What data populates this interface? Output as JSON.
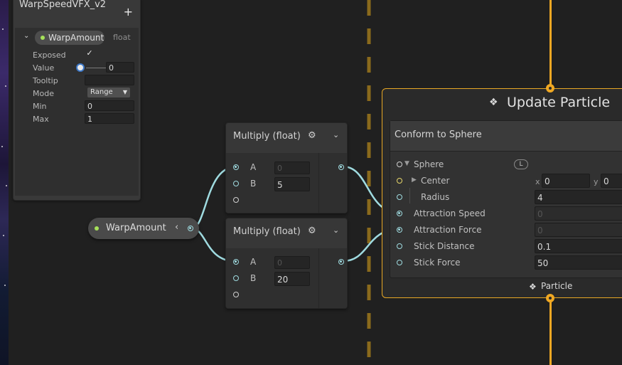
{
  "blackboard": {
    "title": "WarpSpeedVFX_v2",
    "add_icon": "plus-icon",
    "property": {
      "name": "WarpAmount",
      "type": "float",
      "exposed_label": "Exposed",
      "exposed_checked": true,
      "value_label": "Value",
      "value": "0",
      "tooltip_label": "Tooltip",
      "tooltip": "",
      "mode_label": "Mode",
      "mode": "Range",
      "min_label": "Min",
      "min": "0",
      "max_label": "Max",
      "max": "1"
    }
  },
  "warp_node": {
    "label": "WarpAmount"
  },
  "multiply_nodes": [
    {
      "title": "Multiply (float)",
      "a_label": "A",
      "a_value": "0",
      "b_label": "B",
      "b_value": "5"
    },
    {
      "title": "Multiply (float)",
      "a_label": "A",
      "a_value": "0",
      "b_label": "B",
      "b_value": "20"
    }
  ],
  "update_context": {
    "title": "Update Particle",
    "footer": "Particle",
    "block": {
      "title": "Conform to Sphere",
      "space_badge": "L",
      "rows": [
        {
          "label": "Sphere",
          "value": ""
        },
        {
          "label": "Center",
          "x_label": "x",
          "x": "0",
          "y_label": "y",
          "y": "0"
        },
        {
          "label": "Radius",
          "value": "4"
        },
        {
          "label": "Attraction Speed",
          "value": "0"
        },
        {
          "label": "Attraction Force",
          "value": "0"
        },
        {
          "label": "Stick Distance",
          "value": "0.1"
        },
        {
          "label": "Stick Force",
          "value": "50"
        }
      ]
    }
  },
  "colors": {
    "flow_orange": "#f0a823",
    "float_port_cyan": "#9fdbe0",
    "vector_port_yellow": "#e6d66a",
    "exposed_green": "#a6e15a"
  }
}
